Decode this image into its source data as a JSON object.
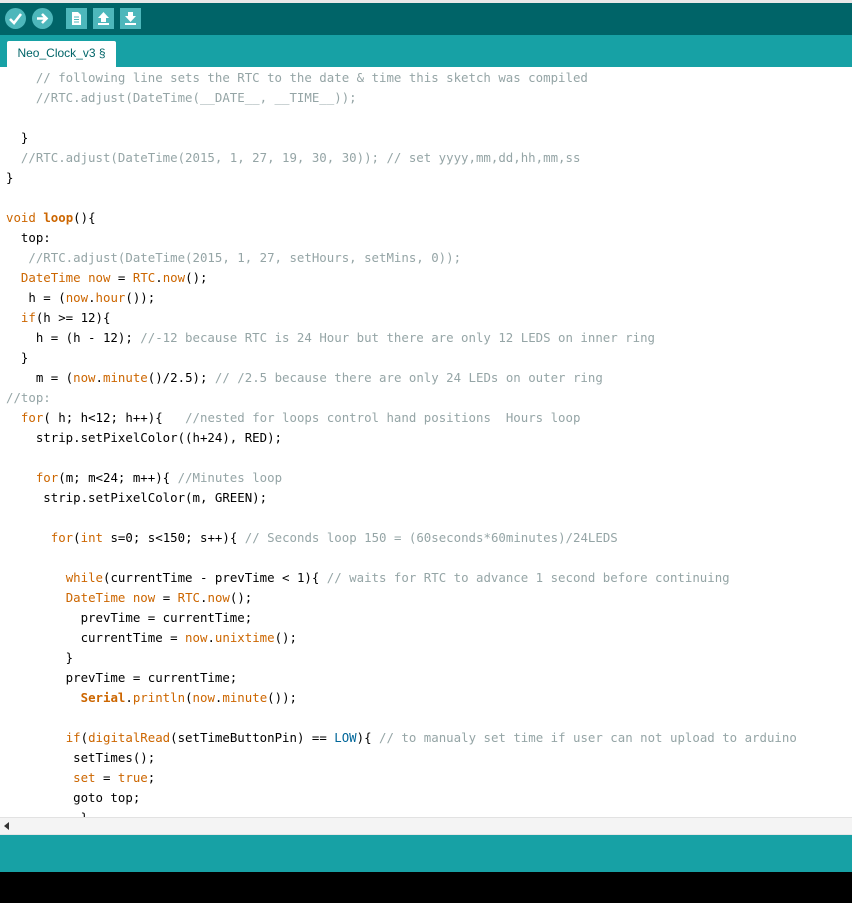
{
  "tab": {
    "label": "Neo_Clock_v3 §"
  },
  "toolbar": {
    "verify": "verify-icon",
    "upload": "upload-icon",
    "new": "new-file-icon",
    "open": "open-icon",
    "save": "save-icon"
  },
  "code": [
    [
      [
        "c",
        "    // following line sets the RTC to the date & time this sketch was compiled"
      ]
    ],
    [
      [
        "c",
        "    //RTC.adjust(DateTime(__DATE__, __TIME__));"
      ]
    ],
    [],
    [
      [
        "",
        "  }"
      ]
    ],
    [
      [
        "c",
        "  //RTC.adjust(DateTime(2015, 1, 27, 19, 30, 30)); // set yyyy,mm,dd,hh,mm,ss"
      ]
    ],
    [
      [
        "",
        "}"
      ]
    ],
    [],
    [
      [
        "k",
        "void"
      ],
      [
        "",
        " "
      ],
      [
        "kb",
        "loop"
      ],
      [
        "",
        "(){"
      ]
    ],
    [
      [
        "",
        "  top:"
      ]
    ],
    [
      [
        "c",
        "   //RTC.adjust(DateTime(2015, 1, 27, setHours, setMins, 0));"
      ]
    ],
    [
      [
        "",
        "  "
      ],
      [
        "k",
        "DateTime"
      ],
      [
        "",
        " "
      ],
      [
        "k",
        "now"
      ],
      [
        "",
        " = "
      ],
      [
        "k",
        "RTC"
      ],
      [
        "",
        "."
      ],
      [
        "k",
        "now"
      ],
      [
        "",
        "();"
      ]
    ],
    [
      [
        "",
        "   h = ("
      ],
      [
        "k",
        "now"
      ],
      [
        "",
        "."
      ],
      [
        "k",
        "hour"
      ],
      [
        "",
        "());"
      ]
    ],
    [
      [
        "",
        "  "
      ],
      [
        "k",
        "if"
      ],
      [
        "",
        "(h >= 12){"
      ]
    ],
    [
      [
        "",
        "    h = (h - 12); "
      ],
      [
        "c",
        "//-12 because RTC is 24 Hour but there are only 12 LEDS on inner ring"
      ]
    ],
    [
      [
        "",
        "  }"
      ]
    ],
    [
      [
        "",
        "    m = ("
      ],
      [
        "k",
        "now"
      ],
      [
        "",
        "."
      ],
      [
        "k",
        "minute"
      ],
      [
        "",
        "()/2.5); "
      ],
      [
        "c",
        "// /2.5 because there are only 24 LEDs on outer ring"
      ]
    ],
    [
      [
        "c",
        "//top:"
      ]
    ],
    [
      [
        "",
        "  "
      ],
      [
        "k",
        "for"
      ],
      [
        "",
        "( h; h<12; h++){   "
      ],
      [
        "c",
        "//nested for loops control hand positions  Hours loop"
      ]
    ],
    [
      [
        "",
        "    strip.setPixelColor((h+24), RED);"
      ]
    ],
    [],
    [
      [
        "",
        "    "
      ],
      [
        "k",
        "for"
      ],
      [
        "",
        "(m; m<24; m++){ "
      ],
      [
        "c",
        "//Minutes loop"
      ]
    ],
    [
      [
        "",
        "     strip.setPixelColor(m, GREEN);"
      ]
    ],
    [],
    [
      [
        "",
        "      "
      ],
      [
        "k",
        "for"
      ],
      [
        "",
        "("
      ],
      [
        "k",
        "int"
      ],
      [
        "",
        " s=0; s<150; s++){ "
      ],
      [
        "c",
        "// Seconds loop 150 = (60seconds*60minutes)/24LEDS"
      ]
    ],
    [],
    [
      [
        "",
        "        "
      ],
      [
        "k",
        "while"
      ],
      [
        "",
        "(currentTime - prevTime < 1){ "
      ],
      [
        "c",
        "// waits for RTC to advance 1 second before continuing"
      ]
    ],
    [
      [
        "",
        "        "
      ],
      [
        "k",
        "DateTime"
      ],
      [
        "",
        " "
      ],
      [
        "k",
        "now"
      ],
      [
        "",
        " = "
      ],
      [
        "k",
        "RTC"
      ],
      [
        "",
        "."
      ],
      [
        "k",
        "now"
      ],
      [
        "",
        "();"
      ]
    ],
    [
      [
        "",
        "          prevTime = currentTime;"
      ]
    ],
    [
      [
        "",
        "          currentTime = "
      ],
      [
        "k",
        "now"
      ],
      [
        "",
        "."
      ],
      [
        "k",
        "unixtime"
      ],
      [
        "",
        "();"
      ]
    ],
    [
      [
        "",
        "        }"
      ]
    ],
    [
      [
        "",
        "        prevTime = currentTime;"
      ]
    ],
    [
      [
        "",
        "          "
      ],
      [
        "kb",
        "Serial"
      ],
      [
        "",
        "."
      ],
      [
        "k",
        "println"
      ],
      [
        "",
        "("
      ],
      [
        "k",
        "now"
      ],
      [
        "",
        "."
      ],
      [
        "k",
        "minute"
      ],
      [
        "",
        "());"
      ]
    ],
    [],
    [
      [
        "",
        "        "
      ],
      [
        "k",
        "if"
      ],
      [
        "",
        "("
      ],
      [
        "k",
        "digitalRead"
      ],
      [
        "",
        "(setTimeButtonPin) == "
      ],
      [
        "l",
        "LOW"
      ],
      [
        "",
        "){ "
      ],
      [
        "c",
        "// to manualy set time if user can not upload to arduino"
      ]
    ],
    [
      [
        "",
        "         setTimes();"
      ]
    ],
    [
      [
        "",
        "         "
      ],
      [
        "k",
        "set"
      ],
      [
        "",
        " = "
      ],
      [
        "k",
        "true"
      ],
      [
        "",
        ";"
      ]
    ],
    [
      [
        "",
        "         goto top;"
      ]
    ],
    [
      [
        "",
        "          }"
      ]
    ]
  ],
  "scrollbar": {
    "left_arrow": "chevron-left-icon"
  }
}
